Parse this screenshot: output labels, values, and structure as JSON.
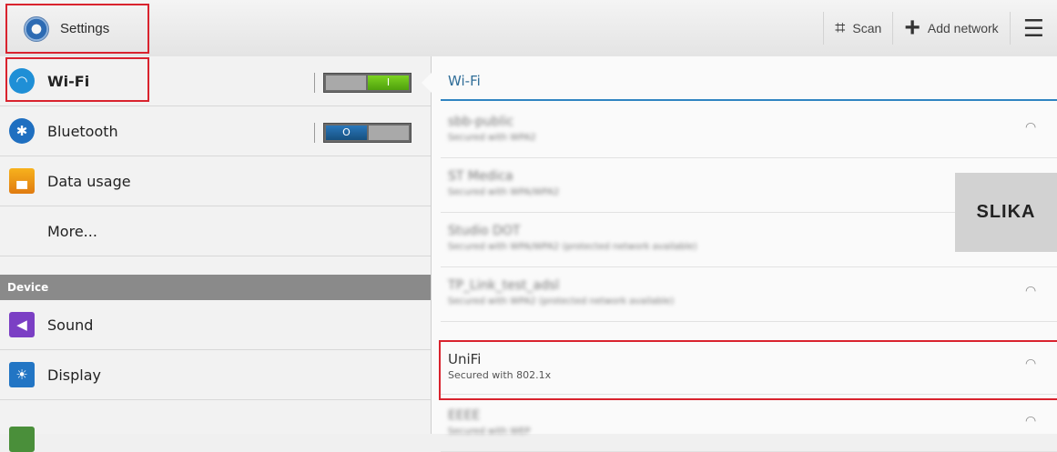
{
  "topbar": {
    "title": "Settings",
    "actions": [
      {
        "label": "Scan",
        "icon": "scan-icon"
      },
      {
        "label": "Add network",
        "icon": "plus-icon"
      }
    ],
    "menu_icon": "overflow-menu-icon"
  },
  "sidebar": {
    "items": [
      {
        "label": "Wi-Fi",
        "icon": "wifi-icon",
        "toggle": "on",
        "toggle_text": "I"
      },
      {
        "label": "Bluetooth",
        "icon": "bluetooth-icon",
        "toggle": "off",
        "toggle_text": "O"
      },
      {
        "label": "Data usage",
        "icon": "data-usage-icon"
      },
      {
        "label": "More..."
      }
    ],
    "section_device": "Device",
    "device_items": [
      {
        "label": "Sound",
        "icon": "sound-icon"
      },
      {
        "label": "Display",
        "icon": "display-icon"
      }
    ]
  },
  "wifi_panel": {
    "title": "Wi-Fi",
    "networks": [
      {
        "name": "sbb-public",
        "status": "Secured with WPA2",
        "blurred": true
      },
      {
        "name": "ST Medica",
        "status": "Secured with WPA/WPA2",
        "blurred": true
      },
      {
        "name": "Studio DOT",
        "status": "Secured with WPA/WPA2 (protected network available)",
        "blurred": true
      },
      {
        "name": "TP_Link_test_adsl",
        "status": "Secured with WPA2 (protected network available)",
        "blurred": true
      },
      {
        "name": "UniFi",
        "status": "Secured with 802.1x",
        "blurred": false
      },
      {
        "name": "EEEE",
        "status": "Secured with WEP",
        "blurred": true
      }
    ]
  },
  "overlay_label": "SLIKA",
  "colors": {
    "highlight": "#d9232e",
    "accent": "#2f84c1",
    "toggle_on": "#5cb415",
    "toggle_off": "#1f6aa9"
  }
}
